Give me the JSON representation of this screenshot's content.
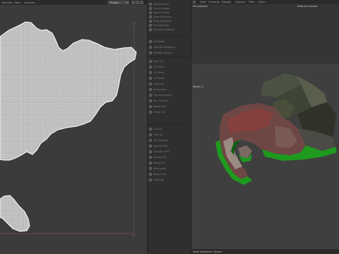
{
  "uv_editor": {
    "menu": [
      "Selection",
      "Pack",
      "Features"
    ],
    "mode_dropdown": "Project",
    "dropdown_arrow": "▾"
  },
  "tools": {
    "group1": [
      "Select Faces",
      "Select Edges",
      "Select Points",
      "Loop Selection",
      "Ring Selection",
      "Fill Selection",
      "UV Island Select"
    ],
    "group2": [
      "UV Relax",
      "Optimal Mapping",
      "Realign Islands"
    ],
    "group3": [
      "Pack UV",
      "UV Stitch",
      "UV Weld",
      "UV Break",
      "Align UV",
      "Straighten",
      "Flip Horizontal",
      "Flip Vertical",
      "Rotate 90",
      "Mirror UV"
    ],
    "group4": [
      "Cut UV",
      "Sew UV",
      "UV Unwrap",
      "Layout UVs",
      "Transfer UVs",
      "Project UV",
      "Reset UV",
      "Normalize",
      "Snap Grid",
      "Settings"
    ]
  },
  "viewport": {
    "menu": [
      "View",
      "Cameras",
      "Display",
      "Options",
      "Filter",
      "Panel"
    ],
    "top_label": "Perspective",
    "camera_label": "Default Camera",
    "bottom_label": "Mode: G",
    "status": "View Transform: Scene"
  },
  "colors": {
    "uv_fill": "#cfcfcf",
    "uv_outline": "#ffffff",
    "land_dark": "#3d4536",
    "roof_red": "#8a3f3c",
    "shore_green": "#1e9a1e"
  }
}
